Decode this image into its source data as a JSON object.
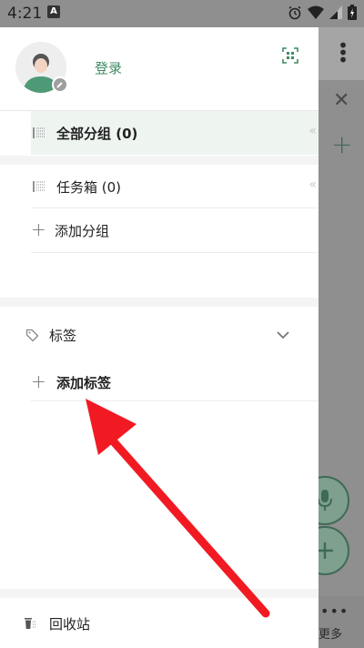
{
  "status_bar": {
    "time": "4:21",
    "notification_icon": "A"
  },
  "drawer": {
    "login_label": "登录",
    "groups": [
      {
        "label": "全部分组 (0)",
        "selected": true
      },
      {
        "label": "任务箱 (0)",
        "selected": false
      }
    ],
    "add_group_label": "添加分组",
    "tags_section_label": "标签",
    "add_tag_label": "添加标签",
    "trash_label": "回收站"
  },
  "background_app": {
    "more_label": "更多"
  },
  "colors": {
    "accent": "#3f8a63",
    "selected_row": "#eef5f1",
    "annotation_arrow": "#f21a22"
  },
  "icons": {
    "scan": "scan-icon",
    "tag": "tag-icon",
    "chevron": "chevron-down-icon",
    "trash": "trash-icon",
    "list": "list-icon",
    "plus": "plus-icon"
  }
}
